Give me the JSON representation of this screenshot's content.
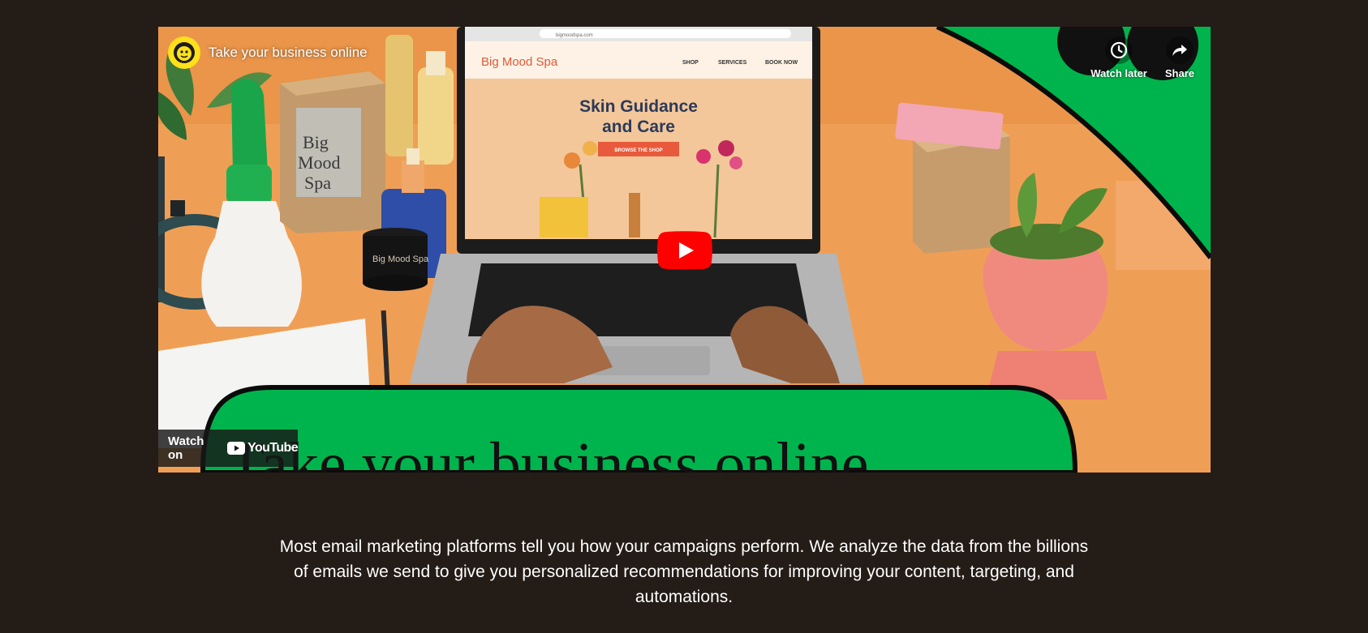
{
  "video": {
    "title": "Take your business online",
    "overlay_banner": "Take your business online",
    "actions": {
      "watch_later": "Watch later",
      "share": "Share"
    },
    "watch_on_label": "Watch on",
    "youtube_word": "YouTube"
  },
  "scene": {
    "laptop_site": {
      "url": "bigmoodspa.com",
      "brand": "Big Mood Spa",
      "nav": [
        "SHOP",
        "SERVICES",
        "BOOK NOW"
      ],
      "headline_line1": "Skin Guidance",
      "headline_line2": "and Care",
      "cta": "BROWSE THE SHOP"
    },
    "box_label": [
      "Big",
      "Mood",
      "Spa"
    ],
    "jar_label": "Big Mood Spa"
  },
  "description": "Most email marketing platforms tell you how your campaigns perform. We analyze the data from the billions of emails we send to give you personalized recommendations for improving your content, targeting, and automations.",
  "colors": {
    "page_background": "#241c17",
    "brand_green": "#00b44d",
    "youtube_red": "#ff0000",
    "mailchimp_yellow": "#ffe01b"
  }
}
